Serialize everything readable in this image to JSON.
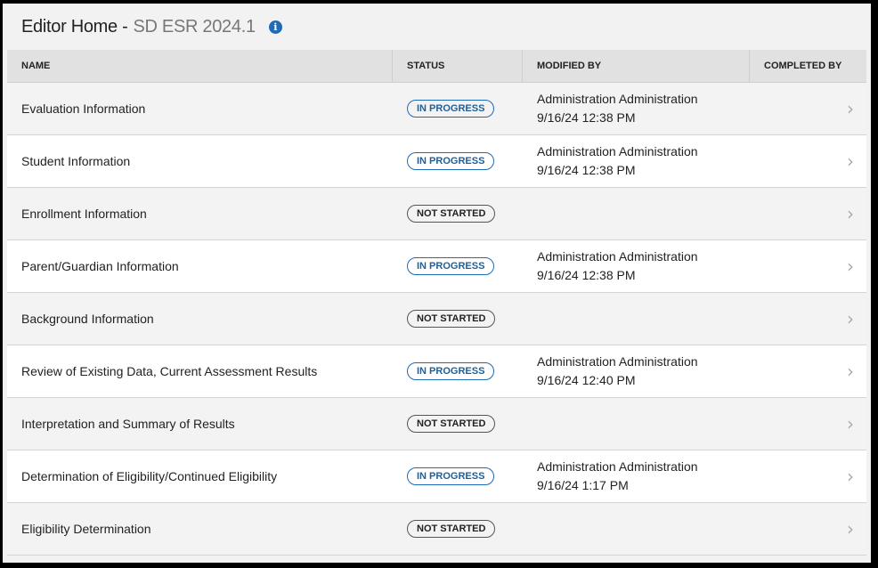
{
  "header": {
    "title": "Editor Home -",
    "subtitle": "SD ESR 2024.1",
    "info_icon": "info-icon"
  },
  "columns": {
    "name": "NAME",
    "status": "STATUS",
    "modified_by": "MODIFIED BY",
    "completed_by": "COMPLETED BY"
  },
  "status_colors": {
    "in_progress": "#1e6bb8",
    "not_started": "#555555"
  },
  "rows": [
    {
      "name": "Evaluation Information",
      "status": "IN PROGRESS",
      "modified_by": "Administration Administration",
      "modified_at": "9/16/24 12:38 PM",
      "completed_by": ""
    },
    {
      "name": "Student Information",
      "status": "IN PROGRESS",
      "modified_by": "Administration Administration",
      "modified_at": "9/16/24 12:38 PM",
      "completed_by": ""
    },
    {
      "name": "Enrollment Information",
      "status": "NOT STARTED",
      "modified_by": "",
      "modified_at": "",
      "completed_by": ""
    },
    {
      "name": "Parent/Guardian Information",
      "status": "IN PROGRESS",
      "modified_by": "Administration Administration",
      "modified_at": "9/16/24 12:38 PM",
      "completed_by": ""
    },
    {
      "name": "Background Information",
      "status": "NOT STARTED",
      "modified_by": "",
      "modified_at": "",
      "completed_by": ""
    },
    {
      "name": "Review of Existing Data, Current Assessment Results",
      "status": "IN PROGRESS",
      "modified_by": "Administration Administration",
      "modified_at": "9/16/24 12:40 PM",
      "completed_by": ""
    },
    {
      "name": "Interpretation and Summary of Results",
      "status": "NOT STARTED",
      "modified_by": "",
      "modified_at": "",
      "completed_by": ""
    },
    {
      "name": "Determination of Eligibility/Continued Eligibility",
      "status": "IN PROGRESS",
      "modified_by": "Administration Administration",
      "modified_at": "9/16/24 1:17 PM",
      "completed_by": ""
    },
    {
      "name": "Eligibility Determination",
      "status": "NOT STARTED",
      "modified_by": "",
      "modified_at": "",
      "completed_by": ""
    }
  ],
  "row_chevron": "›"
}
